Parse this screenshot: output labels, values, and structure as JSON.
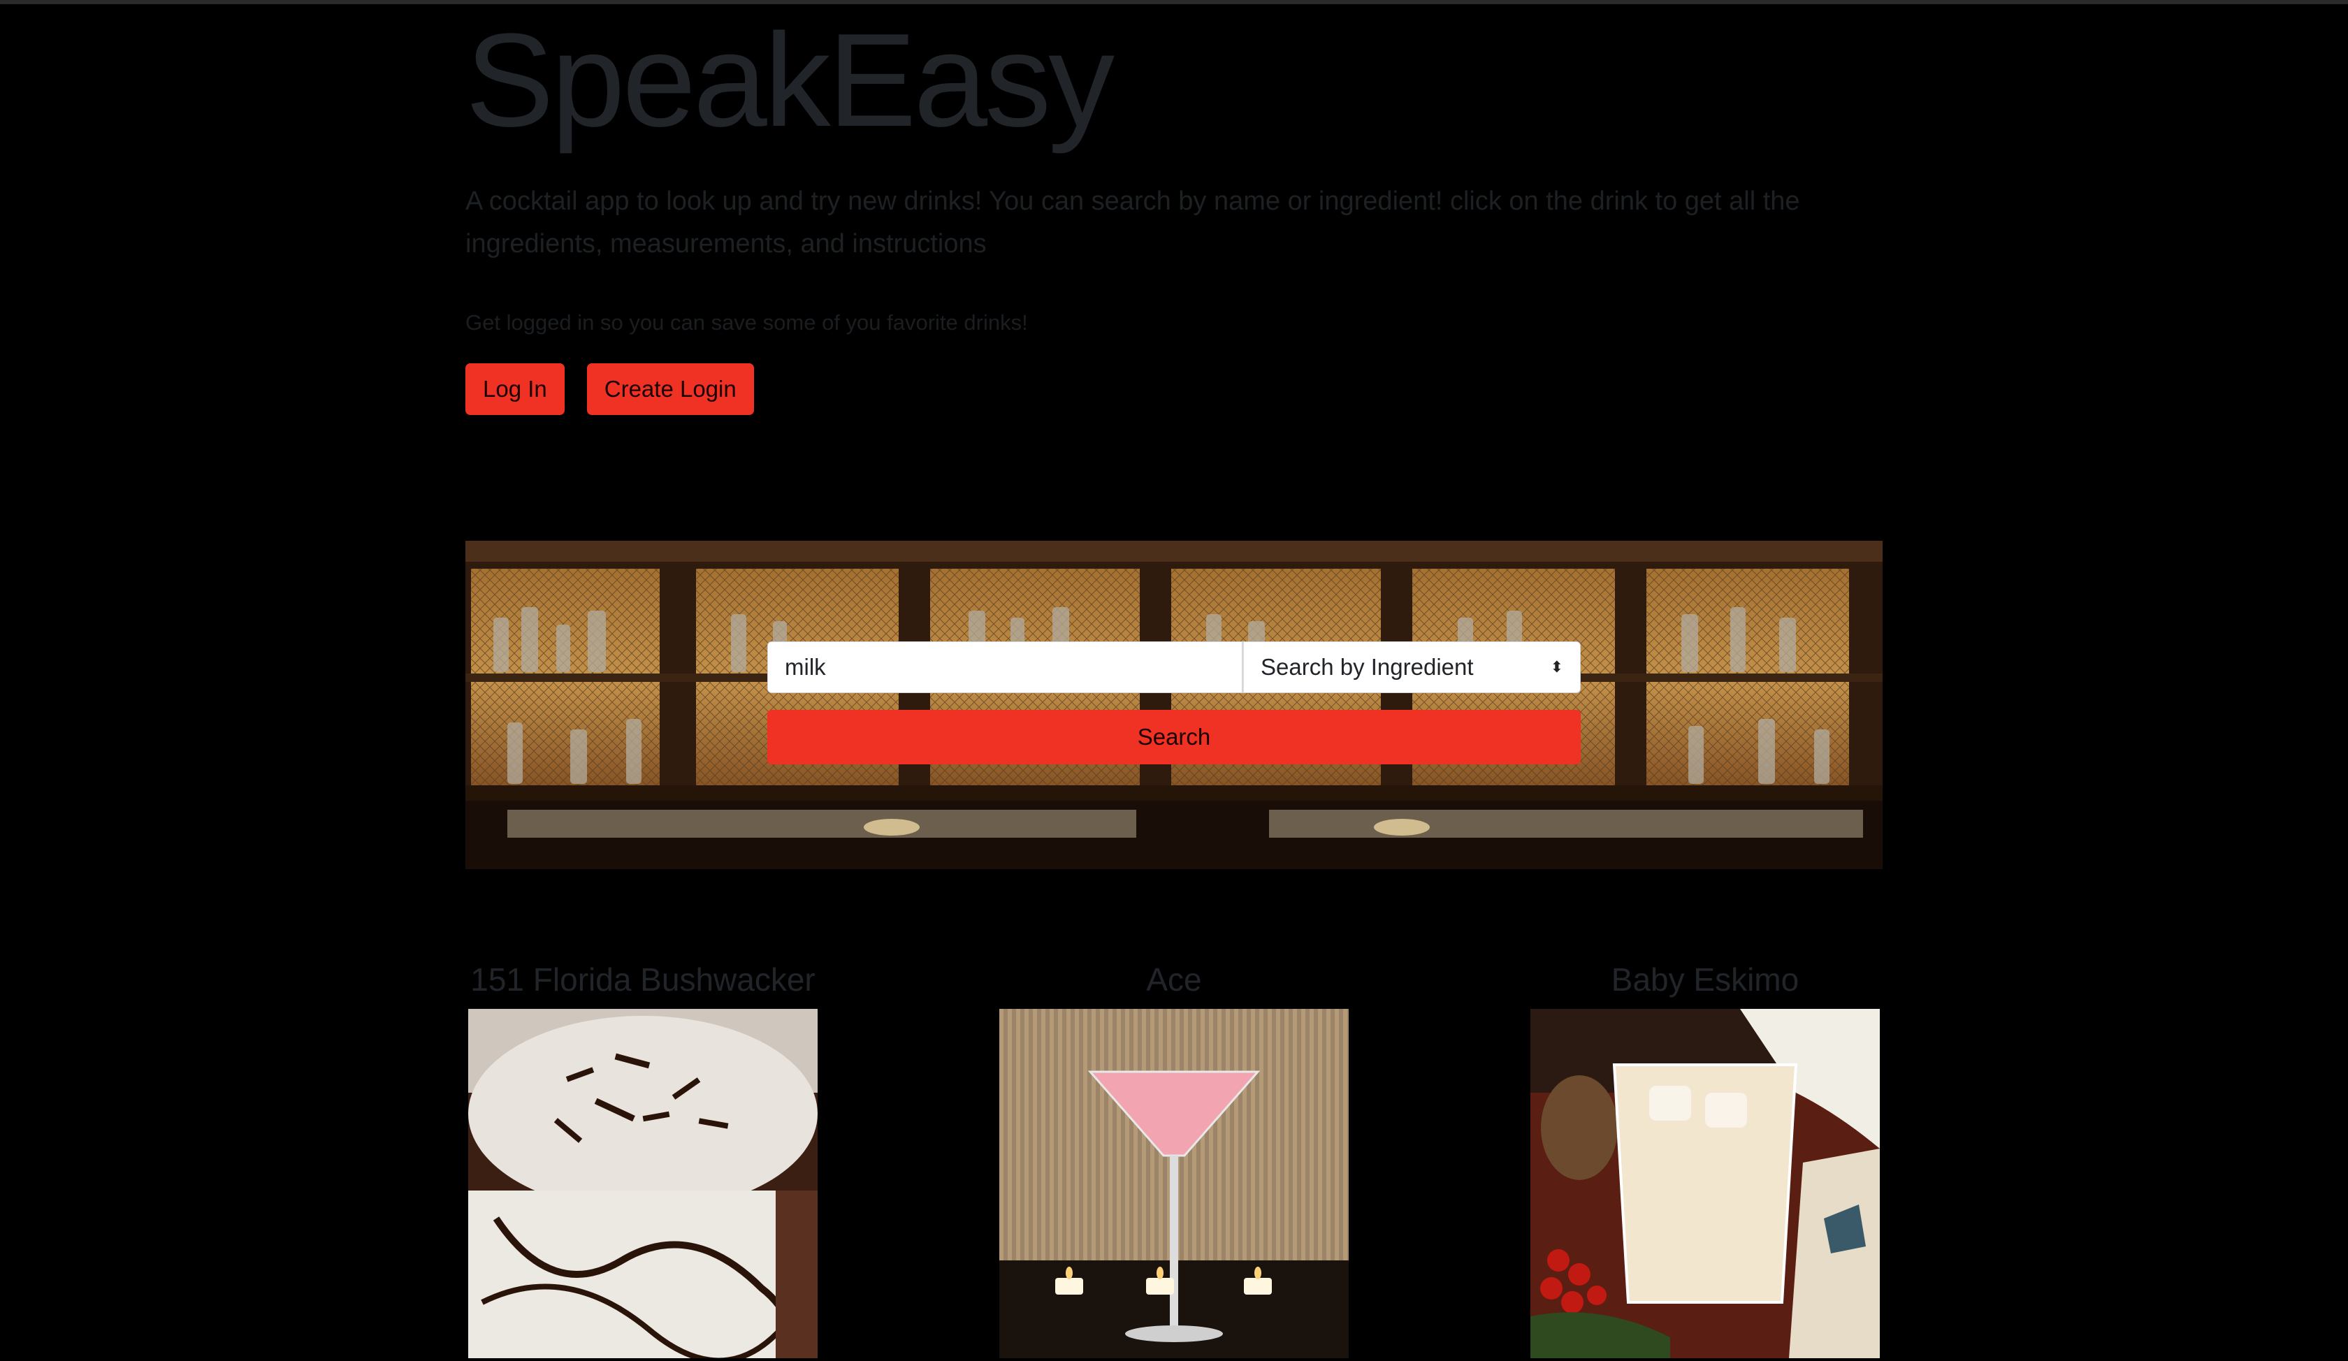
{
  "hero": {
    "title": "SpeakEasy",
    "lead": "A cocktail app to look up and try new drinks! You can search by name or ingredient! click on the drink to get all the ingredients, measurements, and instructions",
    "note": "Get logged in so you can save some of you favorite drinks!",
    "login_label": "Log In",
    "create_label": "Create Login"
  },
  "search": {
    "value": "milk",
    "mode": "Search by Ingredient",
    "button_label": "Search"
  },
  "drinks": [
    {
      "name": "151 Florida Bushwacker"
    },
    {
      "name": "Ace"
    },
    {
      "name": "Baby Eskimo"
    }
  ],
  "colors": {
    "accent": "#ef3224",
    "background": "#000000",
    "muted_text": "#212529"
  }
}
